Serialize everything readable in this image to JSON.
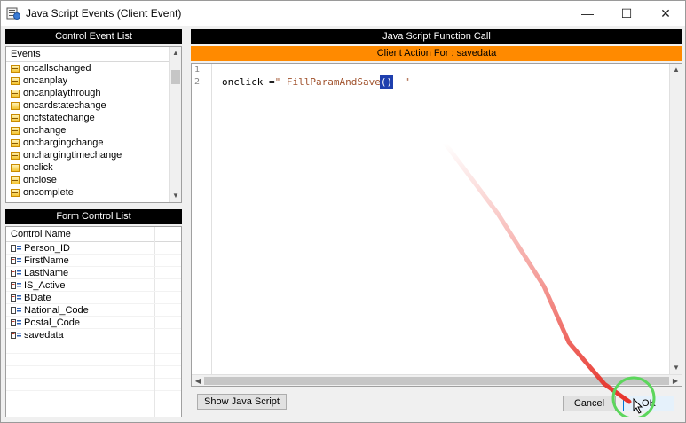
{
  "window": {
    "title": "Java Script Events (Client Event)",
    "icon": "app-script-icon",
    "controls": {
      "minimize": "—",
      "maximize": "☐",
      "close": "✕"
    }
  },
  "control_event_list": {
    "header": "Control Event List",
    "column_header": "Events",
    "items": [
      "oncallschanged",
      "oncanplay",
      "oncanplaythrough",
      "oncardstatechange",
      "oncfstatechange",
      "onchange",
      "onchargingchange",
      "onchargingtimechange",
      "onclick",
      "onclose",
      "oncomplete"
    ],
    "item_icon": "event-icon"
  },
  "form_control_list": {
    "header": "Form Control List",
    "column_header": "Control Name",
    "items": [
      "Person_ID",
      "FirstName",
      "LastName",
      "IS_Active",
      "BDate",
      "National_Code",
      "Postal_Code",
      "savedata"
    ],
    "item_icon": "form-control-icon"
  },
  "function_call": {
    "header": "Java Script Function Call",
    "client_action": "Client Action For : savedata",
    "line_numbers": [
      "1",
      "2"
    ],
    "code": {
      "prefix": "onclick =",
      "quote_open": "\"",
      "function_name": " FillParamAndSave",
      "parens": "()",
      "quote_close": "  \""
    }
  },
  "buttons": {
    "show_js": "Show Java Script",
    "cancel": "Cancel",
    "ok": "OK"
  },
  "colors": {
    "header_bg": "#000000",
    "accent_orange": "#ff8a00",
    "ok_highlight": "#5cd65c",
    "arrow_red": "#e8332a"
  }
}
